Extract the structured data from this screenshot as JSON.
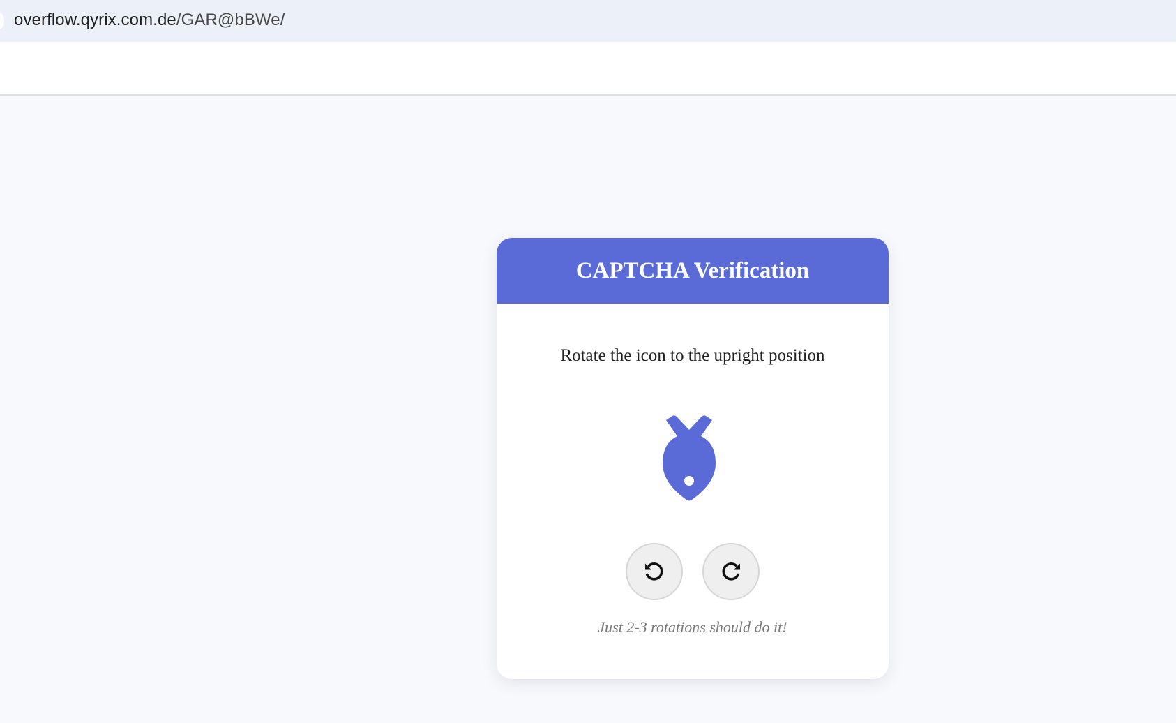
{
  "browser": {
    "url_host": "overflow.qyrix.com.de",
    "url_path": "/GAR@bBWe/"
  },
  "captcha": {
    "title": "CAPTCHA Verification",
    "instruction": "Rotate the icon to the upright position",
    "icon": "fish-icon",
    "rotate_left_icon": "rotate-counterclockwise-icon",
    "rotate_right_icon": "rotate-clockwise-icon",
    "hint": "Just 2-3 rotations should do it!"
  },
  "colors": {
    "accent": "#5a6bd8",
    "page_background": "#f7f9fc",
    "url_bar": "#ecf1f9",
    "button_background": "#efefef",
    "hint_text": "#777777"
  }
}
